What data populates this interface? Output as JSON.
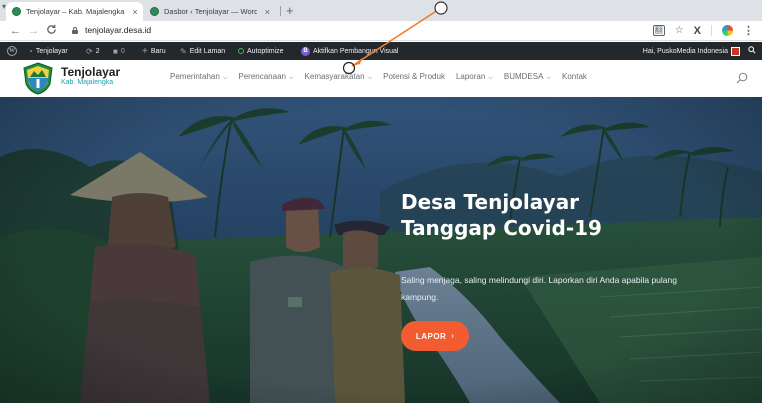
{
  "browser": {
    "tabs": [
      {
        "title": "Tenjolayar – Kab. Majalengka",
        "active": true
      },
      {
        "title": "Dasbor ‹ Tenjolayar — WordP",
        "active": false
      }
    ],
    "tab_close": "×",
    "new_tab": "+",
    "url": "tenjolayar.desa.id",
    "back": "←",
    "forward": "→",
    "reload": "C",
    "translate_icon": "translate-icon",
    "star": "☆",
    "ext_x": "X",
    "menu": "⋮"
  },
  "admin_bar": {
    "site": "Tenjolayar",
    "updates_count": "2",
    "comments_count": "0",
    "new_label": "Baru",
    "edit_label": "Edit Laman",
    "autoptimize_label": "Autoptimize",
    "builder_badge": "B",
    "builder_label": "Aktifkan Pembangun Visual",
    "greeting": "Hai, PuskoMedia Indonesia"
  },
  "site": {
    "title": "Tenjolayar",
    "subtitle": "Kab. Majalengka",
    "nav": [
      {
        "label": "Pemerintahan",
        "dropdown": true
      },
      {
        "label": "Perencanaan",
        "dropdown": true
      },
      {
        "label": "Kemasyarakatan",
        "dropdown": true
      },
      {
        "label": "Potensi & Produk",
        "dropdown": false
      },
      {
        "label": "Laporan",
        "dropdown": true
      },
      {
        "label": "BUMDESA",
        "dropdown": true
      },
      {
        "label": "Kontak",
        "dropdown": false
      }
    ]
  },
  "hero": {
    "title_line1": "Desa Tenjolayar",
    "title_line2": "Tanggap Covid-19",
    "description": "Saling menjaga, saling melindungi diri. Laporkan diri Anda apabila pulang kampung.",
    "button_label": "LAPOR",
    "button_arrow": "›"
  },
  "colors": {
    "admin_bar": "#23282d",
    "accent": "#f25c30",
    "subtitle": "#1aa1b5"
  }
}
